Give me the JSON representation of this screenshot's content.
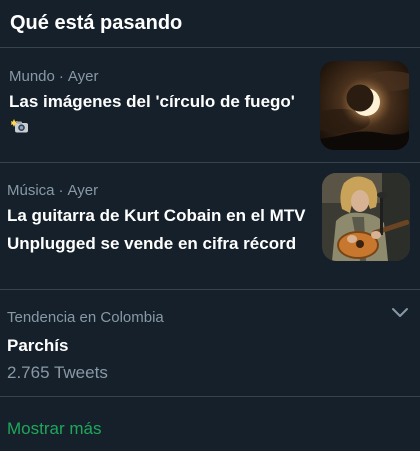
{
  "header": {
    "title": "Qué está pasando"
  },
  "trends": [
    {
      "category": "Mundo",
      "separator": "·",
      "time": "Ayer",
      "headline": "Las imágenes del 'círculo de fuego'",
      "emoji_icon": "camera-flash-icon",
      "thumbnail": "eclipse-ring-image"
    },
    {
      "category": "Música",
      "separator": "·",
      "time": "Ayer",
      "headline": "La guitarra de Kurt Cobain en el MTV Unplugged se vende en cifra récord",
      "thumbnail": "guitarist-photo"
    },
    {
      "context": "Tendencia en Colombia",
      "name": "Parchís",
      "tweet_count": "2.765 Tweets",
      "menu_icon": "chevron-down-icon"
    }
  ],
  "footer": {
    "show_more": "Mostrar más"
  },
  "colors": {
    "background": "#15202b",
    "divider": "#38444d",
    "secondary_text": "#8899a6",
    "link": "#1fa75a"
  }
}
